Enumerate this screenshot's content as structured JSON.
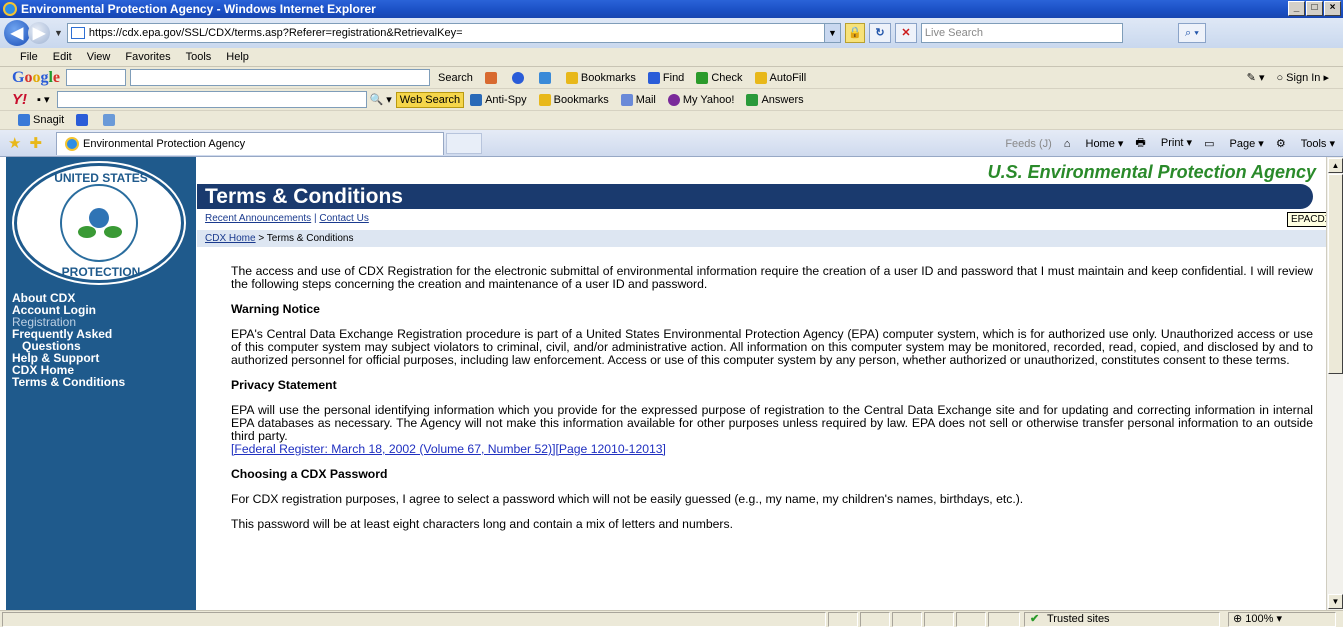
{
  "window": {
    "title": "Environmental Protection Agency - Windows Internet Explorer"
  },
  "address": {
    "url": "https://cdx.epa.gov/SSL/CDX/terms.asp?Referer=registration&RetrievalKey=",
    "search_placeholder": "Live Search"
  },
  "menu": [
    "File",
    "Edit",
    "View",
    "Favorites",
    "Tools",
    "Help"
  ],
  "google_toolbar": {
    "search": "Search",
    "bookmarks": "Bookmarks",
    "find": "Find",
    "check": "Check",
    "autofill": "AutoFill",
    "sign_in": "Sign In"
  },
  "yahoo_toolbar": {
    "web_search": "Web Search",
    "anti_spy": "Anti-Spy",
    "bookmarks": "Bookmarks",
    "mail": "Mail",
    "my_yahoo": "My Yahoo!",
    "answers": "Answers"
  },
  "snagit_toolbar": {
    "snagit": "Snagit"
  },
  "tabs": [
    {
      "label": "Environmental Protection Agency"
    }
  ],
  "command_bar": {
    "feeds": "Feeds (J)",
    "home": "Home",
    "print": "Print",
    "page": "Page",
    "tools": "Tools"
  },
  "sidebar": {
    "seal_top": "UNITED STATES",
    "seal_bottom": "PROTECTION",
    "items": [
      {
        "label": "About CDX"
      },
      {
        "label": "Account Login"
      },
      {
        "label": "Registration"
      },
      {
        "label": "Frequently Asked"
      },
      {
        "label": "Questions"
      },
      {
        "label": "Help & Support"
      },
      {
        "label": "CDX Home"
      },
      {
        "label": "Terms & Conditions"
      }
    ]
  },
  "page": {
    "agency": "U.S. Environmental Protection Agency",
    "title": "Terms & Conditions",
    "links": {
      "recent": "Recent Announcements",
      "sep": "|",
      "contact": "Contact Us"
    },
    "breadcrumb": {
      "home": "CDX Home",
      "current": "> Terms & Conditions"
    },
    "tooltip": "EPACDX",
    "intro": "The access and use of CDX Registration for the electronic submittal of environmental information require the creation of a user ID and password that I must maintain and keep confidential. I will review the following steps concerning the creation and maintenance of a user ID and password.",
    "warning_heading": "Warning Notice",
    "warning_text": "EPA's Central Data Exchange Registration procedure is part of a United States Environmental Protection Agency (EPA) computer system, which is for authorized use only. Unauthorized access or use of this computer system may subject violators to criminal, civil, and/or administrative action. All information on this computer system may be monitored, recorded, read, copied, and disclosed by and to authorized personnel for official purposes, including law enforcement. Access or use of this computer system by any person, whether authorized or unauthorized, constitutes consent to these terms.",
    "privacy_heading": "Privacy Statement",
    "privacy_text": "EPA will use the personal identifying information which you provide for the expressed purpose of registration to the Central Data Exchange site and for updating and correcting information in internal EPA databases as necessary. The Agency will not make this information available for other purposes unless required by law. EPA does not sell or otherwise transfer personal information to an outside third party.",
    "privacy_link": "[Federal Register: March 18, 2002 (Volume 67, Number 52)][Page 12010-12013]",
    "password_heading": "Choosing a CDX Password",
    "password_text": "For CDX registration purposes, I agree to select a password which will not be easily guessed (e.g., my name, my children's names, birthdays, etc.).",
    "password_text2": "This password will be at least eight characters long and contain a mix of letters and numbers."
  },
  "status": {
    "zone": "Trusted sites",
    "zoom": "100%"
  }
}
